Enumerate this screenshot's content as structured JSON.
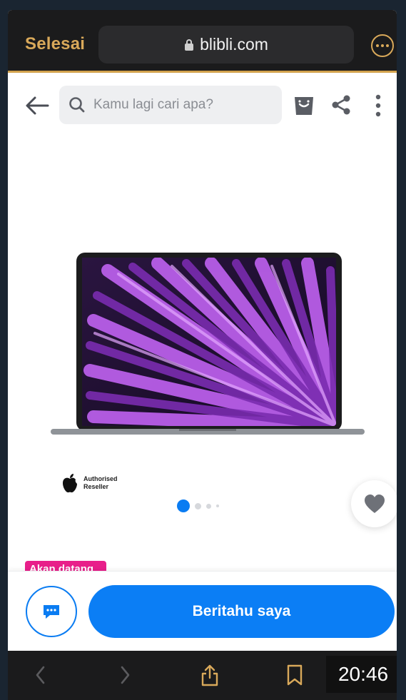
{
  "browser": {
    "done_label": "Selesai",
    "url": "blibli.com"
  },
  "header": {
    "search_placeholder": "Kamu lagi cari apa?"
  },
  "product": {
    "reseller_line1": "Authorised",
    "reseller_line2": "Reseller",
    "badge": "Akan datang",
    "image_count": 4,
    "current_image": 1
  },
  "actions": {
    "notify_label": "Beritahu saya"
  },
  "toolbar": {
    "time": "20:46"
  },
  "colors": {
    "accent": "#0b7ef5",
    "browser_accent": "#d9a95a",
    "badge": "#e81f8a"
  }
}
